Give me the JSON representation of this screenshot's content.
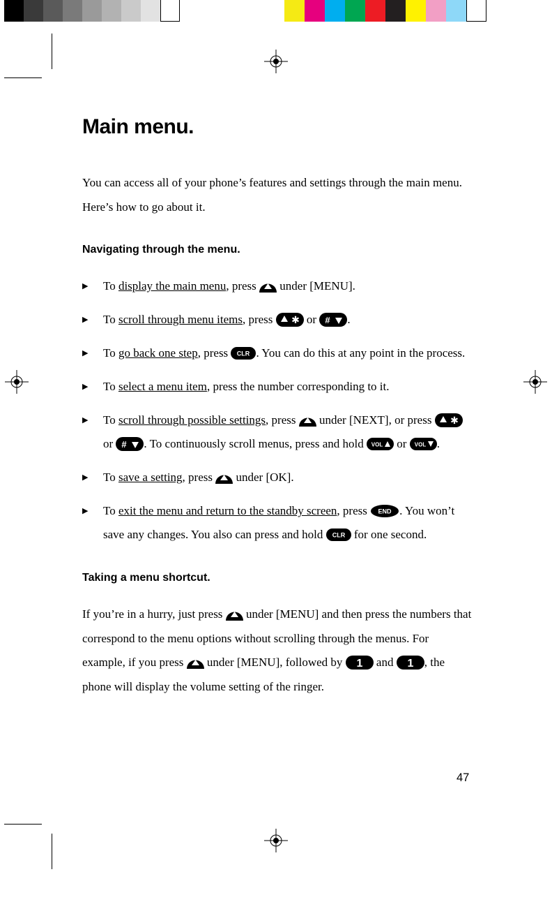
{
  "swatches_left": [
    "#000000",
    "#3a3a3a",
    "#5a5a5a",
    "#7a7a7a",
    "#9a9a9a",
    "#b2b2b2",
    "#cacaca",
    "#e2e2e2",
    "#ffffff"
  ],
  "swatches_right": [
    "#f5ea14",
    "#e6007e",
    "#00aeef",
    "#00a651",
    "#ed1c24",
    "#231f20",
    "#fff200",
    "#f29fc5",
    "#8ed8f8",
    "#ffffff"
  ],
  "page_number": "47",
  "title": "Main menu.",
  "intro": "You can access all of your phone’s features and settings through the main menu. Here’s how to go about it.",
  "subhead1": "Navigating through the menu.",
  "subhead2": "Taking a menu shortcut.",
  "b1": {
    "pre": "To ",
    "u": "display the main menu",
    "post1": ", press ",
    "post2": " under [MENU]."
  },
  "b2": {
    "pre": "To ",
    "u": "scroll through menu items",
    "post1": ", press ",
    "or": " or ",
    "end": "."
  },
  "b3": {
    "pre": "To ",
    "u": "go back one step",
    "post1": ", press ",
    "post2": ". You can do this at any point in the process."
  },
  "b4": {
    "pre": "To ",
    "u": "select a menu item",
    "post": ", press the number corresponding to it."
  },
  "b5": {
    "pre": "To ",
    "u": "scroll through possible settings",
    "post1": ", press ",
    "post2": " under [NEXT], or press ",
    "or1": " or ",
    "post3": ". To continuously scroll menus, press and hold ",
    "or2": " or ",
    "end": "."
  },
  "b6": {
    "pre": "To ",
    "u": "save a setting",
    "post1": ", press ",
    "post2": " under [OK]."
  },
  "b7": {
    "pre": "To ",
    "u": "exit the menu and return to the standby screen",
    "post1": ", press ",
    "post2": ". You won’t save any changes. You also can press and hold ",
    "post3": " for one second."
  },
  "shortcut": {
    "s1": "If you’re in a hurry, just press ",
    "s2": " under [MENU] and then press the numbers that correspond to the menu options without scrolling through the menus. For example, if you press ",
    "s3": " under [MENU], followed by ",
    "s4": " and ",
    "s5": ", the phone will display the volume setting of the ringer."
  },
  "keys": {
    "clr": "CLR",
    "end": "END",
    "vol": "VOL",
    "digit1": "1"
  }
}
